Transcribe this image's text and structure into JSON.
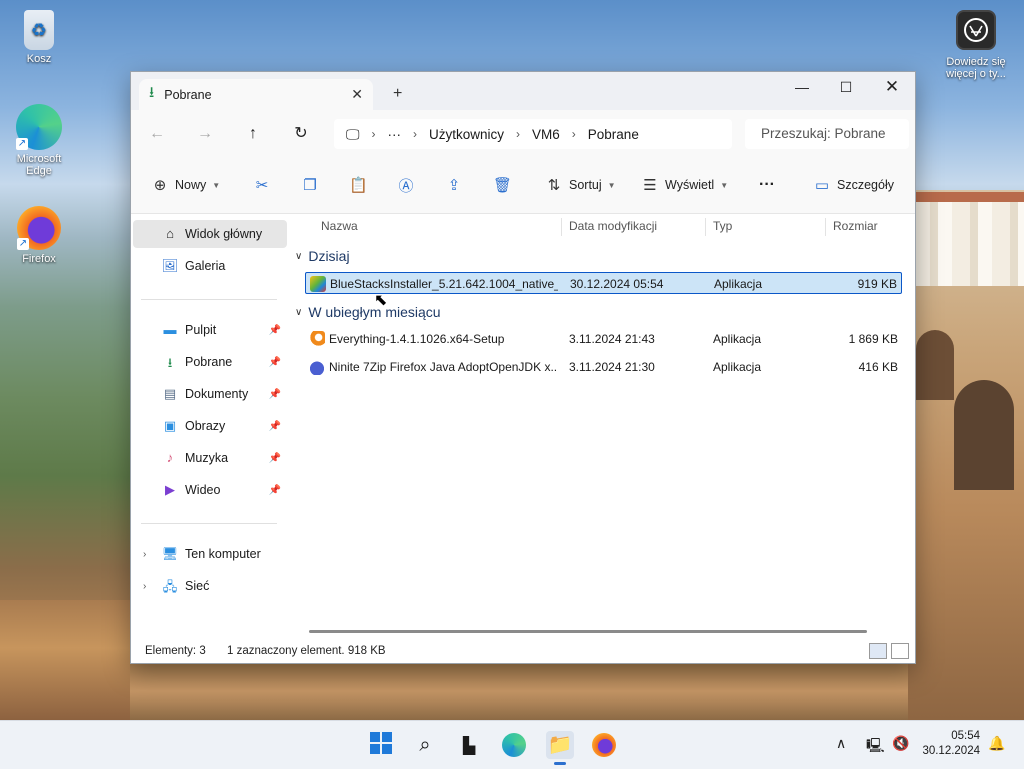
{
  "desktop": {
    "icons": [
      {
        "label": "Kosz",
        "icon": "recycle-bin-icon"
      },
      {
        "label": "Microsoft Edge",
        "icon": "edge-icon"
      },
      {
        "label": "Firefox",
        "icon": "firefox-icon"
      }
    ],
    "notice_label": "Dowiedz się więcej o ty..."
  },
  "explorer": {
    "tab_title": "Pobrane",
    "new_tab": "+",
    "address": {
      "ellipsis": "···",
      "crumbs": [
        "Użytkownicy",
        "VM6",
        "Pobrane"
      ]
    },
    "search_placeholder": "Przeszukaj: Pobrane",
    "toolbar": {
      "new_label": "Nowy",
      "sort_label": "Sortuj",
      "view_label": "Wyświetl",
      "more_label": "···",
      "details_label": "Szczegóły"
    },
    "sidebar": {
      "top": [
        {
          "label": "Widok główny",
          "icon": "home-icon"
        },
        {
          "label": "Galeria",
          "icon": "gallery-icon"
        }
      ],
      "pinned": [
        {
          "label": "Pulpit",
          "icon": "desktop-folder-icon"
        },
        {
          "label": "Pobrane",
          "icon": "downloads-icon"
        },
        {
          "label": "Dokumenty",
          "icon": "documents-icon"
        },
        {
          "label": "Obrazy",
          "icon": "pictures-icon"
        },
        {
          "label": "Muzyka",
          "icon": "music-icon"
        },
        {
          "label": "Wideo",
          "icon": "video-icon"
        }
      ],
      "bottom": [
        {
          "label": "Ten komputer",
          "icon": "this-pc-icon"
        },
        {
          "label": "Sieć",
          "icon": "network-icon"
        }
      ]
    },
    "columns": {
      "name": "Nazwa",
      "date": "Data modyfikacji",
      "type": "Typ",
      "size": "Rozmiar"
    },
    "groups": [
      {
        "title": "Dzisiaj",
        "files": [
          {
            "name": "BlueStacksInstaller_5.21.642.1004_native_...",
            "date": "30.12.2024 05:54",
            "type": "Aplikacja",
            "size": "919 KB",
            "selected": true
          }
        ]
      },
      {
        "title": "W ubiegłym miesiącu",
        "files": [
          {
            "name": "Everything-1.4.1.1026.x64-Setup",
            "date": "3.11.2024 21:43",
            "type": "Aplikacja",
            "size": "1 869 KB",
            "selected": false
          },
          {
            "name": "Ninite 7Zip Firefox Java AdoptOpenJDK x...",
            "date": "3.11.2024 21:30",
            "type": "Aplikacja",
            "size": "416 KB",
            "selected": false
          }
        ]
      }
    ],
    "status": {
      "count": "Elementy: 3",
      "selection": "1 zaznaczony element. 918 KB"
    }
  },
  "taskbar": {
    "clock_time": "05:54",
    "clock_date": "30.12.2024"
  }
}
